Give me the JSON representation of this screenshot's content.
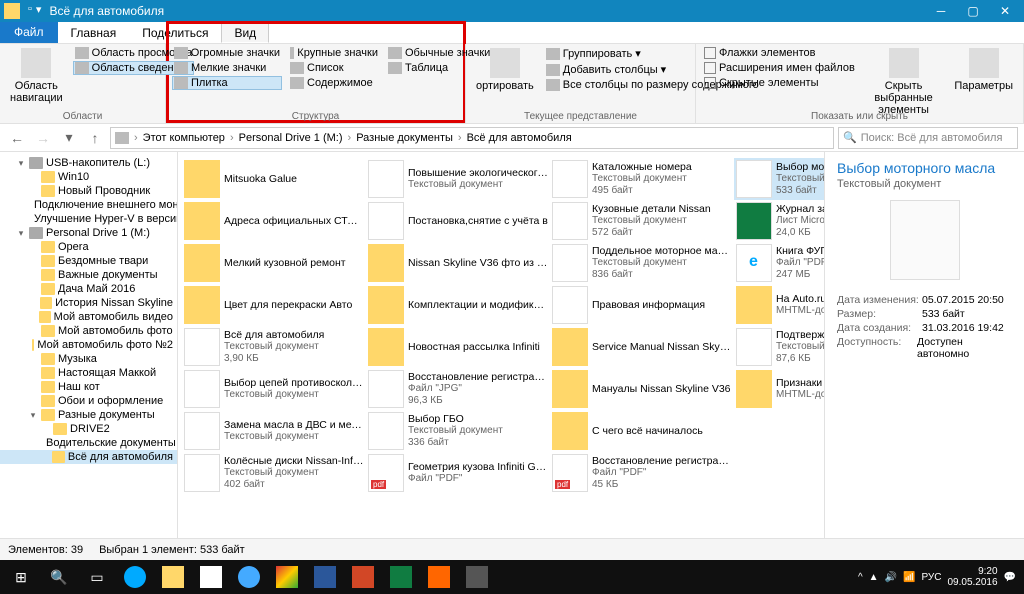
{
  "window": {
    "title": "Всё для автомобиля"
  },
  "tabs": {
    "file": "Файл",
    "home": "Главная",
    "share": "Поделиться",
    "view": "Вид"
  },
  "ribbon": {
    "panes": {
      "nav": "Область навигации",
      "preview": "Область просмотра",
      "details": "Область сведений",
      "group": "Области"
    },
    "layout": {
      "xlarge": "Огромные значки",
      "large": "Крупные значки",
      "medium": "Обычные значки",
      "small": "Мелкие значки",
      "list": "Список",
      "detailsv": "Таблица",
      "tiles": "Плитка",
      "content": "Содержимое",
      "group": "Структура"
    },
    "current": {
      "sort": "ортировать",
      "groupby": "Группировать",
      "addcols": "Добавить столбцы",
      "sizecols": "Все столбцы по размеру содержимого",
      "group": "Текущее представление"
    },
    "showhide": {
      "checkboxes": "Флажки элементов",
      "extensions": "Расширения имен файлов",
      "hidden": "Скрытые элементы",
      "hidesel": "Скрыть выбранные элементы",
      "options": "Параметры",
      "group": "Показать или скрыть"
    }
  },
  "breadcrumb": [
    "Этот компьютер",
    "Personal Drive 1 (M:)",
    "Разные документы",
    "Всё для автомобиля"
  ],
  "search": {
    "placeholder": "Поиск: Всё для автомобиля"
  },
  "tree": [
    {
      "l": 1,
      "t": "d",
      "n": "USB-накопитель (L:)",
      "exp": "▾"
    },
    {
      "l": 2,
      "t": "f",
      "n": "Win10"
    },
    {
      "l": 2,
      "t": "f",
      "n": "Новый Проводник"
    },
    {
      "l": 2,
      "t": "f",
      "n": "Подключение внешнего монитора"
    },
    {
      "l": 2,
      "t": "f",
      "n": "Улучшение Hyper-V в версии"
    },
    {
      "l": 1,
      "t": "d",
      "n": "Personal Drive 1 (M:)",
      "exp": "▾"
    },
    {
      "l": 2,
      "t": "f",
      "n": "Opera"
    },
    {
      "l": 2,
      "t": "f",
      "n": "Бездомные твари"
    },
    {
      "l": 2,
      "t": "f",
      "n": "Важные документы"
    },
    {
      "l": 2,
      "t": "f",
      "n": "Дача Май 2016"
    },
    {
      "l": 2,
      "t": "f",
      "n": "История Nissan Skyline"
    },
    {
      "l": 2,
      "t": "f",
      "n": "Мой автомобиль видео"
    },
    {
      "l": 2,
      "t": "f",
      "n": "Мой автомобиль фото"
    },
    {
      "l": 2,
      "t": "f",
      "n": "Мой автомобиль фото №2"
    },
    {
      "l": 2,
      "t": "f",
      "n": "Музыка"
    },
    {
      "l": 2,
      "t": "f",
      "n": "Настоящая Маккой"
    },
    {
      "l": 2,
      "t": "f",
      "n": "Наш кот"
    },
    {
      "l": 2,
      "t": "f",
      "n": "Обои и оформление"
    },
    {
      "l": 2,
      "t": "f",
      "n": "Разные документы",
      "exp": "▾"
    },
    {
      "l": 3,
      "t": "f",
      "n": "DRIVE2"
    },
    {
      "l": 3,
      "t": "f",
      "n": "Водительские документы"
    },
    {
      "l": 3,
      "t": "f",
      "n": "Всё для автомобиля",
      "sel": true
    }
  ],
  "files": [
    {
      "i": "folder",
      "n": "Mitsuoka Galue"
    },
    {
      "i": "folder",
      "n": "Адреса официальных СТО Nissan-Infiniti"
    },
    {
      "i": "folder",
      "n": "Мелкий кузовной ремонт"
    },
    {
      "i": "folder",
      "n": "Цвет для перекраски Авто"
    },
    {
      "i": "txt",
      "n": "Всё для автомобиля",
      "t": "Текстовый документ",
      "s": "3,90 КБ"
    },
    {
      "i": "txt",
      "n": "Выбор цепей противоскольжения",
      "t": "Текстовый документ"
    },
    {
      "i": "txt",
      "n": "Замена масла в ДВС и мелкие запчасти",
      "t": "Текстовый документ"
    },
    {
      "i": "txt",
      "n": "Колёсные диски Nissan-Infiniti",
      "t": "Текстовый документ",
      "s": "402 байт"
    },
    {
      "i": "txt",
      "n": "Повышение экологического класса автомобиля и сертифик…",
      "t": "Текстовый документ"
    },
    {
      "i": "txt",
      "n": "Постановка,снятие с учёта в",
      "t": ""
    },
    {
      "i": "folder",
      "n": "Nissan Skyline V36 фто из интернета"
    },
    {
      "i": "folder",
      "n": "Комплектации и модификации"
    },
    {
      "i": "folder",
      "n": "Новостная рассылка Infiniti"
    },
    {
      "i": "jpg",
      "n": "Восстановление регистрации ТС",
      "t": "Файл \"JPG\"",
      "s": "96,3 КБ"
    },
    {
      "i": "txt",
      "n": "Выбор ГБО",
      "t": "Текстовый документ",
      "s": "336 байт"
    },
    {
      "i": "pdf",
      "n": "Геометрия кузова Infiniti G Sedan V36",
      "t": "Файл \"PDF\""
    },
    {
      "i": "txt",
      "n": "Каталожные номера",
      "t": "Текстовый документ",
      "s": "495 байт"
    },
    {
      "i": "txt",
      "n": "Кузовные детали Nissan",
      "t": "Текстовый документ",
      "s": "572 байт"
    },
    {
      "i": "txt",
      "n": "Поддельное моторное масло",
      "t": "Текстовый документ",
      "s": "836 байт"
    },
    {
      "i": "txt",
      "n": "Правовая информация",
      "t": ""
    },
    {
      "i": "folder",
      "n": "Service Manual Nissan Skyline V36"
    },
    {
      "i": "folder",
      "n": "Мануалы Nissan Skyline V36"
    },
    {
      "i": "folder",
      "n": "С чего всё начиналось"
    },
    {
      "i": "pdf",
      "n": "Восстановление регистрации ТС",
      "t": "Файл \"PDF\"",
      "s": "45 КБ"
    },
    {
      "i": "txt",
      "n": "Выбор моторного масла",
      "t": "Текстовый документ",
      "s": "533 байт",
      "sel": true
    },
    {
      "i": "xls",
      "n": "Журнал замены масла и ТО",
      "t": "Лист Microsoft Excel",
      "s": "24,0 КБ"
    },
    {
      "i": "ie",
      "n": "Книга ФУГА",
      "t": "Файл \"PDF\"",
      "s": "247 МБ"
    },
    {
      "i": "folder",
      "n": "На Auto.ru появилась проверка автомобилей по VIN-коду",
      "t": "MHTML-документ"
    },
    {
      "i": "txt",
      "n": "Подтверждение регистрации",
      "t": "Текстовый документ",
      "s": "87,6 КБ"
    },
    {
      "i": "folder",
      "n": "Признаки подделки масла Nissan",
      "t": "MHTML-документ"
    }
  ],
  "details": {
    "title": "Выбор моторного масла",
    "type": "Текстовый документ",
    "props": [
      {
        "k": "Дата изменения:",
        "v": "05.07.2015 20:50"
      },
      {
        "k": "Размер:",
        "v": "533 байт"
      },
      {
        "k": "Дата создания:",
        "v": "31.03.2016 19:42"
      },
      {
        "k": "Доступность:",
        "v": "Доступен автономно"
      }
    ]
  },
  "status": {
    "items": "Элементов: 39",
    "selected": "Выбран 1 элемент: 533 байт"
  },
  "tray": {
    "lang": "РУС",
    "time": "9:20",
    "date": "09.05.2016"
  }
}
